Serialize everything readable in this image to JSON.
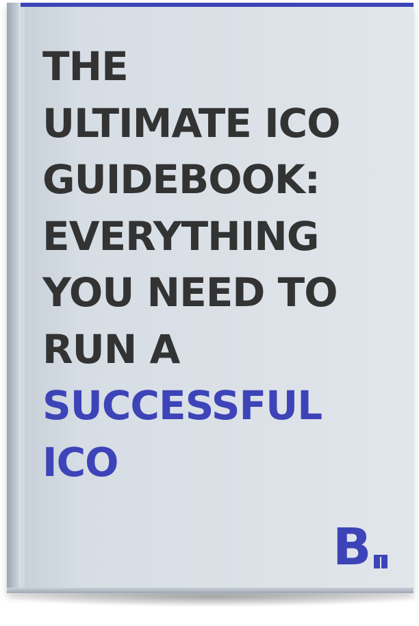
{
  "cover": {
    "title_lines": [
      "THE",
      "ULTIMATE ICO",
      "GUIDEBOOK:",
      "EVERYTHING",
      "YOU NEED TO",
      "RUN A"
    ],
    "title_accent_lines": [
      "SUCCESSFUL",
      "ICO"
    ],
    "logo_letter": "B",
    "colors": {
      "title_text": "#333333",
      "accent": "#3d44b8",
      "cover_background": "#dbe1e7"
    }
  }
}
